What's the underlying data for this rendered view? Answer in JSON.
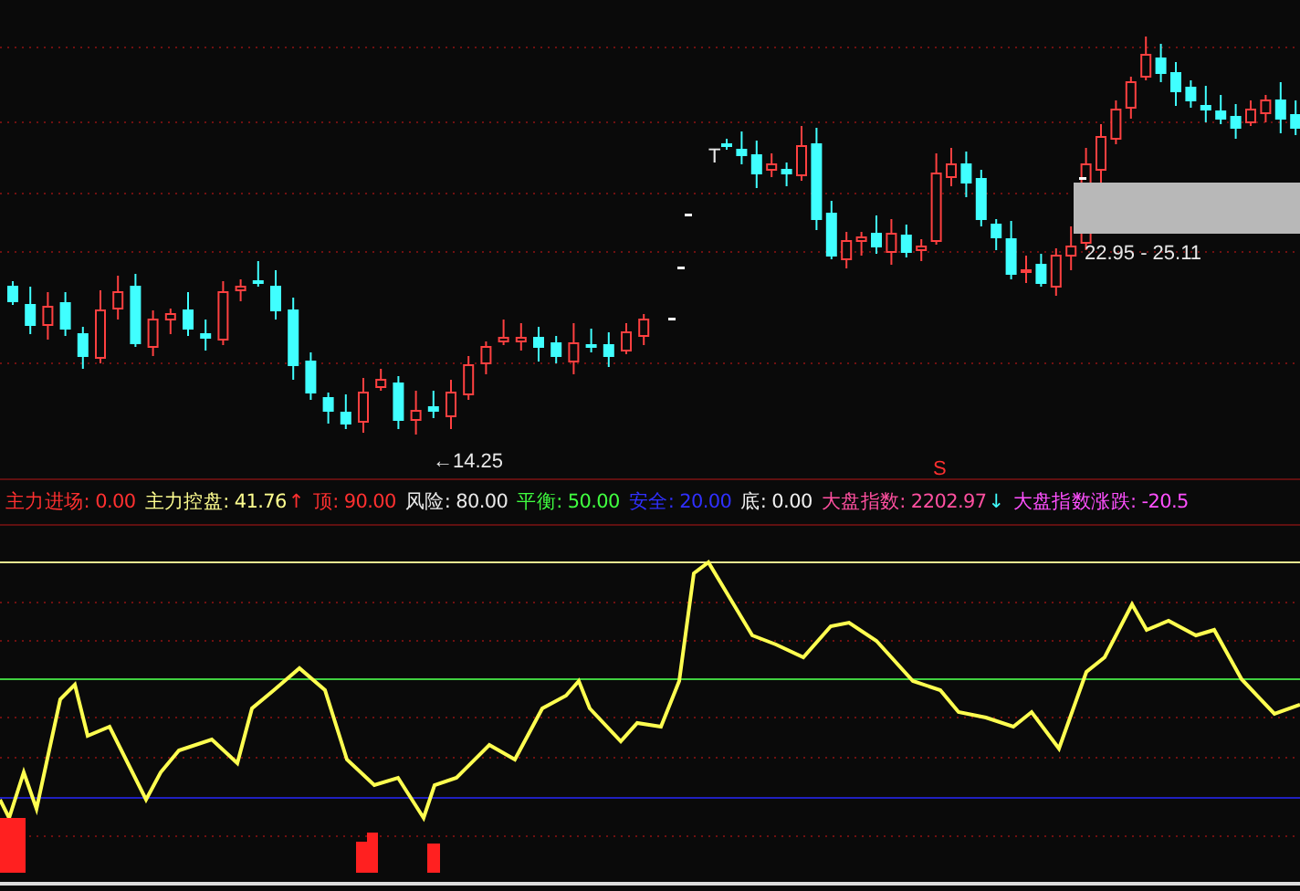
{
  "price_chart": {
    "high_marker": "T",
    "range_label": "22.95 - 25.11",
    "low_label": "←14.25",
    "signal_marker": "S"
  },
  "indicators": [
    {
      "label": "主力进场:",
      "value": "0.00",
      "color": "#ff3030"
    },
    {
      "label": "主力控盘:",
      "value": "41.76",
      "color": "#ffff90",
      "arrow": {
        "symbol": "↑",
        "color": "#ff3030"
      }
    },
    {
      "label": "顶:",
      "value": "90.00",
      "color": "#ff3030"
    },
    {
      "label": "风险:",
      "value": "80.00",
      "color": "#e8e8e8"
    },
    {
      "label": "平衡:",
      "value": "50.00",
      "color": "#40ff40"
    },
    {
      "label": "安全:",
      "value": "20.00",
      "color": "#3030ff"
    },
    {
      "label": "底:",
      "value": "0.00",
      "color": "#f0f0f0"
    },
    {
      "label": "大盘指数:",
      "value": "2202.97",
      "color": "#ff50a0",
      "arrow": {
        "symbol": "↓",
        "color": "#40ffff"
      }
    },
    {
      "label": "大盘指数涨跌:",
      "value": "-20.5",
      "color": "#ff50ff"
    }
  ]
}
